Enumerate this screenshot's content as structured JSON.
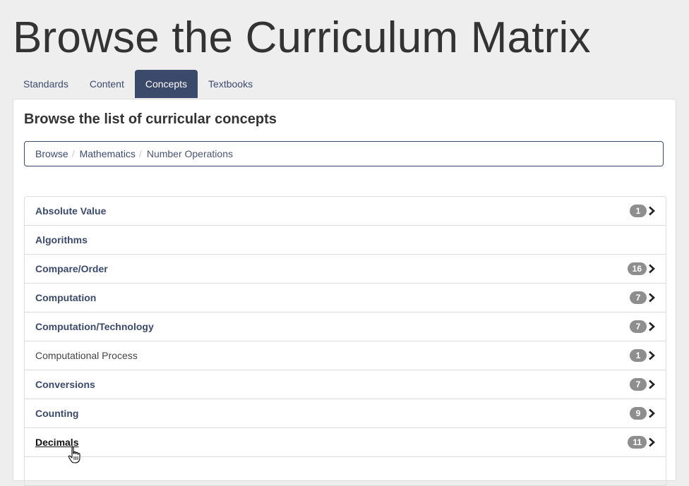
{
  "page": {
    "title": "Browse the Curriculum Matrix"
  },
  "tabs": [
    {
      "label": "Standards",
      "active": false
    },
    {
      "label": "Content",
      "active": false
    },
    {
      "label": "Concepts",
      "active": true
    },
    {
      "label": "Textbooks",
      "active": false
    }
  ],
  "panel": {
    "heading": "Browse the list of curricular concepts"
  },
  "breadcrumb": {
    "items": [
      "Browse",
      "Mathematics",
      "Number Operations"
    ],
    "separator": "/"
  },
  "concepts": [
    {
      "label": "Absolute Value",
      "count": "1"
    },
    {
      "label": "Algorithms",
      "count": null
    },
    {
      "label": "Compare/Order",
      "count": "16"
    },
    {
      "label": "Computation",
      "count": "7"
    },
    {
      "label": "Computation/Technology",
      "count": "7"
    },
    {
      "label": "Computational Process",
      "count": "1"
    },
    {
      "label": "Conversions",
      "count": "7"
    },
    {
      "label": "Counting",
      "count": "9"
    },
    {
      "label": "Decimals",
      "count": "11"
    }
  ],
  "colors": {
    "accent": "#3b4a6b",
    "badge": "#8e8e8e",
    "background": "#eeeeee"
  },
  "icons": {
    "row_arrow": "chevron-right-icon",
    "pointer": "hand-cursor-icon"
  }
}
